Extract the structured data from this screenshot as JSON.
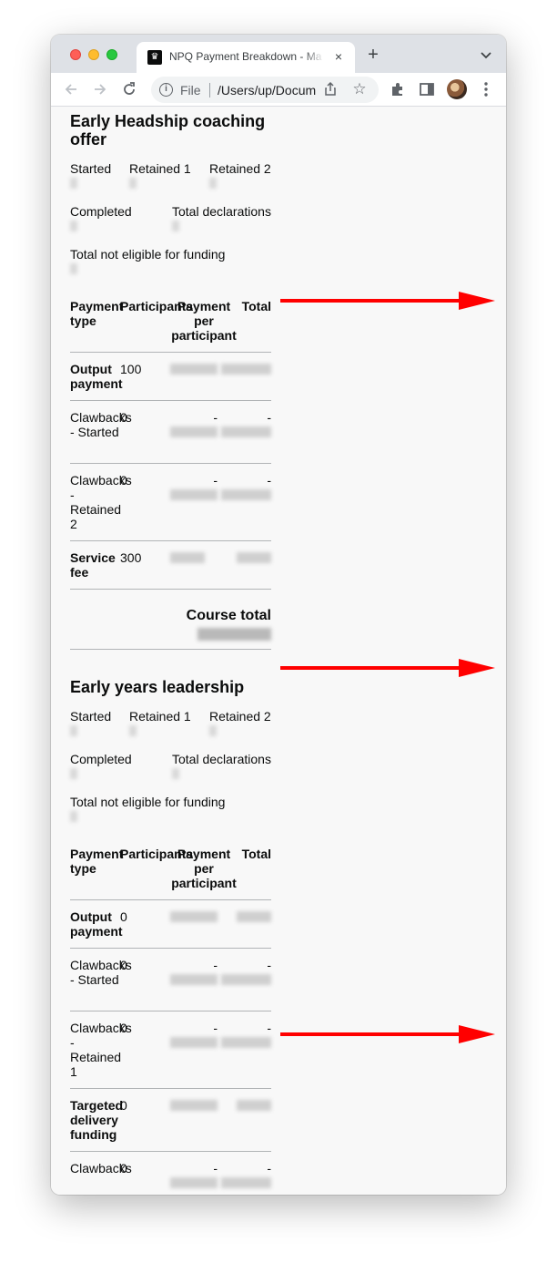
{
  "browser": {
    "tab_title": "NPQ Payment Breakdown - Ma",
    "tab_close": "×",
    "new_tab": "+",
    "url_scheme": "File",
    "url": "/Users/up/Documents",
    "favicon_glyph": "♛"
  },
  "courses": [
    {
      "title": "Early Headship coaching offer",
      "stats": {
        "started_label": "Started",
        "retained1_label": "Retained 1",
        "retained2_label": "Retained 2",
        "completed_label": "Completed",
        "total_declarations_label": "Total declarations",
        "not_eligible_label": "Total not eligible for funding"
      },
      "headers": [
        "Payment type",
        "Participants",
        "Payment per participant",
        "Total"
      ],
      "rows": [
        {
          "type": "Output payment",
          "participants": "100",
          "per": "-",
          "total": "-"
        },
        {
          "type": "Clawbacks - Started",
          "participants": "0",
          "per": "-",
          "total": "-"
        },
        {
          "type": "Clawbacks - Retained 2",
          "participants": "0",
          "per": "-",
          "total": "-"
        },
        {
          "type": "Service fee",
          "participants": "300",
          "per": "",
          "total": ""
        }
      ],
      "course_total_label": "Course total"
    },
    {
      "title": "Early years leadership",
      "stats": {
        "started_label": "Started",
        "retained1_label": "Retained 1",
        "retained2_label": "Retained 2",
        "completed_label": "Completed",
        "total_declarations_label": "Total declarations",
        "not_eligible_label": "Total not eligible for funding"
      },
      "headers": [
        "Payment type",
        "Participants",
        "Payment per participant",
        "Total"
      ],
      "rows": [
        {
          "type": "Output payment",
          "participants": "0",
          "per": "",
          "total": ""
        },
        {
          "type": "Clawbacks - Started",
          "participants": "0",
          "per": "-",
          "total": "-"
        },
        {
          "type": "Clawbacks - Retained 1",
          "participants": "0",
          "per": "-",
          "total": "-"
        },
        {
          "type": "Targeted delivery funding",
          "participants": "0",
          "per": "",
          "total": ""
        },
        {
          "type": "Clawbacks",
          "participants": "0",
          "per": "-",
          "total": "-"
        }
      ]
    }
  ],
  "annotation_color": "#ff0000"
}
